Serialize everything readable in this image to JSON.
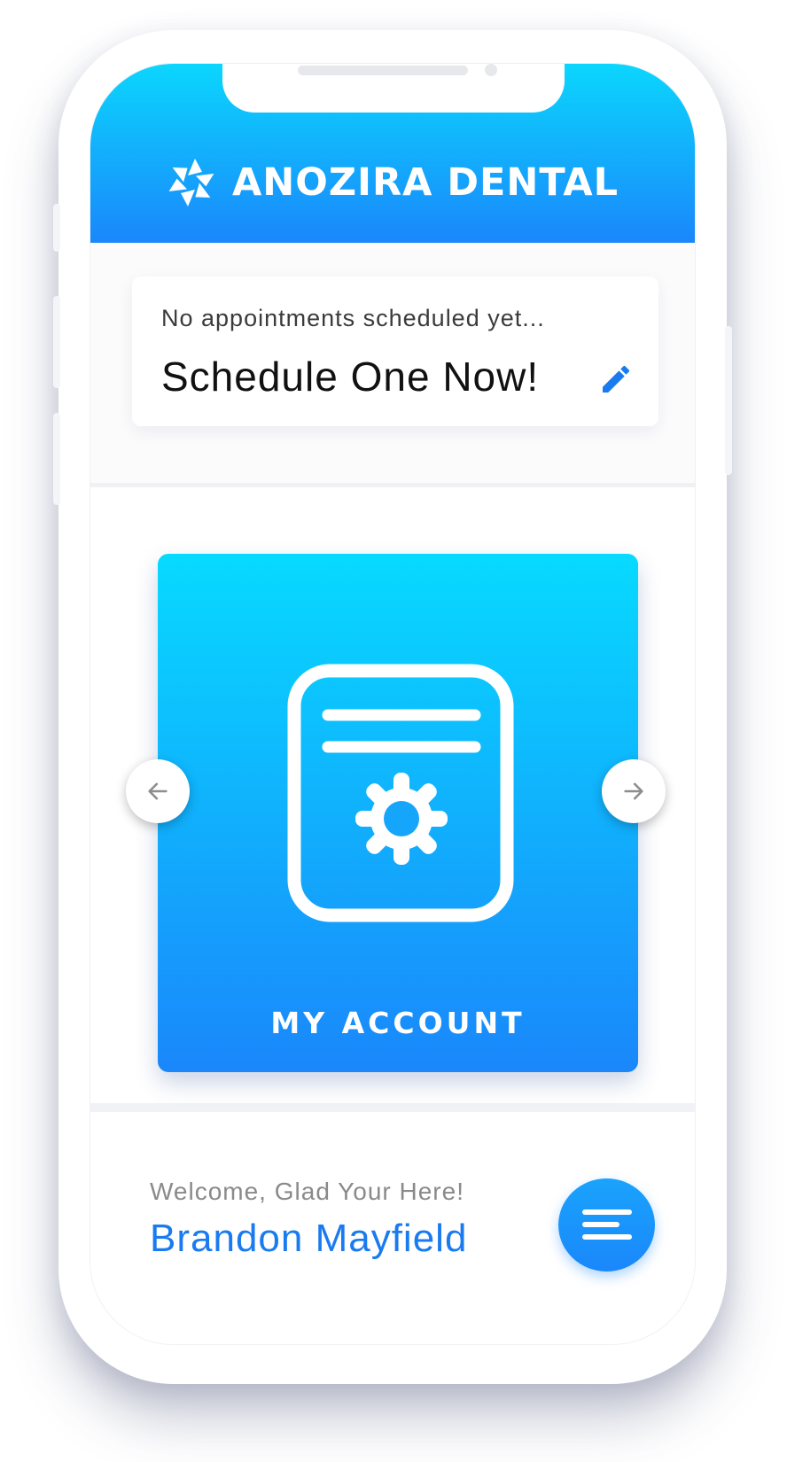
{
  "header": {
    "brand_name": "ANOZIRA DENTAL",
    "logo_icon": "pinwheel-logo-icon"
  },
  "appointment": {
    "status_text": "No appointments scheduled yet...",
    "cta_text": "Schedule One Now!",
    "edit_icon": "pencil-icon"
  },
  "carousel": {
    "card_label": "MY ACCOUNT",
    "card_icon": "document-gear-icon",
    "prev_icon": "arrow-left-icon",
    "next_icon": "arrow-right-icon"
  },
  "footer": {
    "greeting": "Welcome, Glad Your Here!",
    "user_name": "Brandon Mayfield",
    "menu_icon": "menu-lines-icon"
  },
  "colors": {
    "gradient_top": "#07daff",
    "gradient_bottom": "#1a87fb",
    "accent": "#1a7bf0"
  }
}
